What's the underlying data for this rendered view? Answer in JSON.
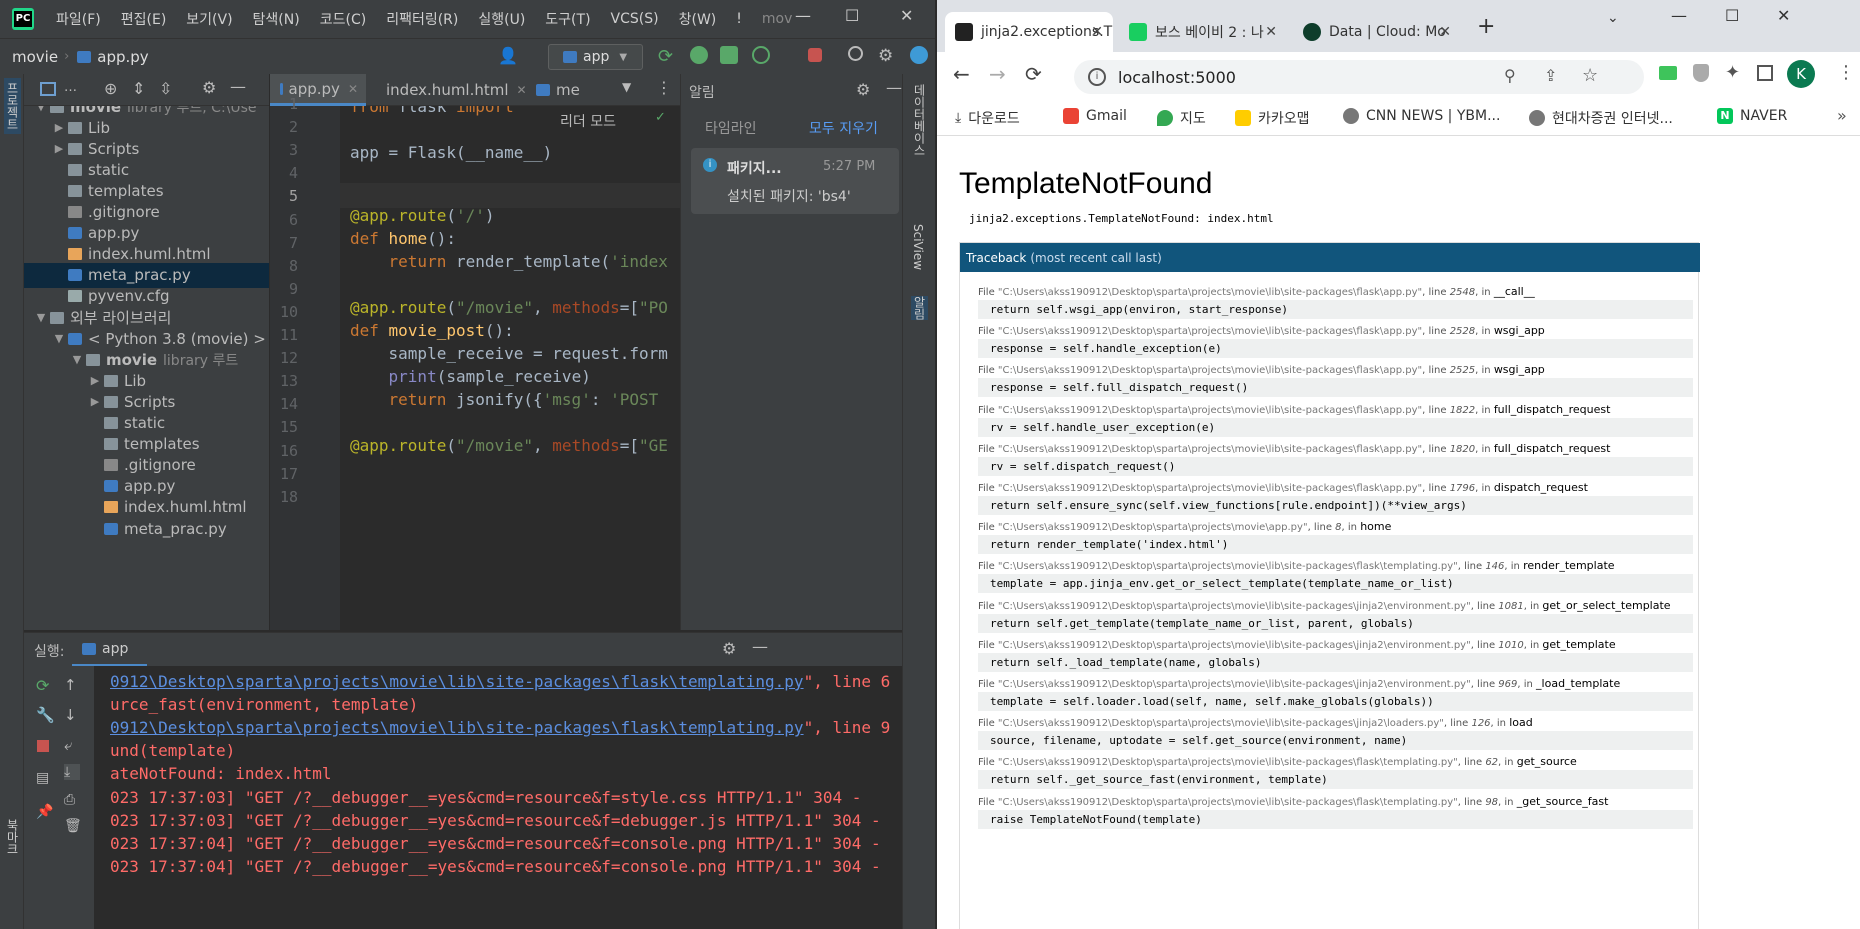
{
  "ide": {
    "menu": [
      "파일(F)",
      "편집(E)",
      "보기(V)",
      "탐색(N)",
      "코드(C)",
      "리팩터링(R)",
      "실행(U)",
      "도구(T)",
      "VCS(S)",
      "창(W)",
      "!",
      "mov"
    ],
    "breadcrumb": {
      "project": "movie",
      "file": "app.py"
    },
    "run_config": "app",
    "left_strip_label": "프로젝트",
    "left_strip_bottom": "북마크",
    "project_tree": [
      {
        "label": "movie",
        "suffix": "library 루트, C:\\Use",
        "type": "folder",
        "open": true
      },
      {
        "label": "Lib",
        "type": "folder"
      },
      {
        "label": "Scripts",
        "type": "folder"
      },
      {
        "label": "static",
        "type": "folder"
      },
      {
        "label": "templates",
        "type": "folder"
      },
      {
        "label": ".gitignore",
        "type": "git"
      },
      {
        "label": "app.py",
        "type": "py"
      },
      {
        "label": "index.huml.html",
        "type": "html"
      },
      {
        "label": "meta_prac.py",
        "type": "py",
        "selected": true
      },
      {
        "label": "pyvenv.cfg",
        "type": "cfg"
      },
      {
        "label": "외부 라이브러리",
        "type": "lib",
        "open": true
      },
      {
        "label": "< Python 3.8 (movie) >",
        "type": "py",
        "open": true
      },
      {
        "label": "movie",
        "suffix": "library 루트",
        "type": "folder",
        "open": true
      },
      {
        "label": "Lib",
        "type": "folder"
      },
      {
        "label": "Scripts",
        "type": "folder"
      },
      {
        "label": "static",
        "type": "folder"
      },
      {
        "label": "templates",
        "type": "folder"
      },
      {
        "label": ".gitignore",
        "type": "git"
      },
      {
        "label": "app.py",
        "type": "py"
      },
      {
        "label": "index.huml.html",
        "type": "html"
      },
      {
        "label": "meta_prac.py",
        "type": "py"
      }
    ],
    "tabs": [
      {
        "label": "app.py",
        "active": true
      },
      {
        "label": "index.huml.html"
      },
      {
        "label": "me"
      }
    ],
    "reader_mode": "리더 모드",
    "line_numbers": [
      "1",
      "2",
      "3",
      "4",
      "5",
      "6",
      "7",
      "8",
      "9",
      "10",
      "11",
      "12",
      "13",
      "14",
      "15",
      "16",
      "17",
      "18"
    ],
    "notifications": {
      "title": "알림",
      "timeline": "타임라인",
      "clear_all": "모두 지우기",
      "item_title": "패키지...",
      "item_time": "5:27 PM",
      "item_body": "설치된 패키지: 'bs4'"
    },
    "right_strip": [
      "데이터베이스",
      "SciView",
      "알림"
    ],
    "run": {
      "label": "실행:",
      "config": "app"
    },
    "console": [
      {
        "text": "0912\\Desktop\\sparta\\projects\\movie\\lib\\site-packages\\flask\\templating.py",
        "tail": "\", line 6",
        "link": true
      },
      {
        "text": "urce_fast(environment, template)"
      },
      {
        "text": "0912\\Desktop\\sparta\\projects\\movie\\lib\\site-packages\\flask\\templating.py",
        "tail": "\", line 9",
        "link": true
      },
      {
        "text": "und(template)"
      },
      {
        "text": "ateNotFound: index.html"
      },
      {
        "text": "023 17:37:03] \"GET /?__debugger__=yes&cmd=resource&f=style.css HTTP/1.1\" 304 -"
      },
      {
        "text": "023 17:37:03] \"GET /?__debugger__=yes&cmd=resource&f=debugger.js HTTP/1.1\" 304 -"
      },
      {
        "text": "023 17:37:04] \"GET /?__debugger__=yes&cmd=resource&f=console.png HTTP/1.1\" 304 -"
      },
      {
        "text": "023 17:37:04] \"GET /?__debugger__=yes&cmd=resource&f=console.png HTTP/1.1\" 304 -"
      }
    ]
  },
  "browser": {
    "tabs": [
      {
        "label": "jinja2.exceptions.T",
        "active": true
      },
      {
        "label": "보스 베이비 2 : 나"
      },
      {
        "label": "Data | Cloud: Mo"
      }
    ],
    "url": "localhost:5000",
    "profile": "K",
    "bookmarks": [
      "다운로드",
      "Gmail",
      "지도",
      "카카오맵",
      "CNN NEWS | YBM...",
      "현대차증권 인터넷...",
      "NAVER"
    ],
    "error_title": "TemplateNotFound",
    "error_message": "jinja2.exceptions.TemplateNotFound: index.html",
    "traceback_label": "Traceback",
    "traceback_note": "(most recent call last)",
    "frames": [
      {
        "path": "\"C:\\Users\\akss190912\\Desktop\\sparta\\projects\\movie\\lib\\site-packages\\flask\\app.py\"",
        "line": "2548",
        "func": "__call__",
        "code": "return self.wsgi_app(environ, start_response)"
      },
      {
        "path": "\"C:\\Users\\akss190912\\Desktop\\sparta\\projects\\movie\\lib\\site-packages\\flask\\app.py\"",
        "line": "2528",
        "func": "wsgi_app",
        "code": "response = self.handle_exception(e)"
      },
      {
        "path": "\"C:\\Users\\akss190912\\Desktop\\sparta\\projects\\movie\\lib\\site-packages\\flask\\app.py\"",
        "line": "2525",
        "func": "wsgi_app",
        "code": "response = self.full_dispatch_request()"
      },
      {
        "path": "\"C:\\Users\\akss190912\\Desktop\\sparta\\projects\\movie\\lib\\site-packages\\flask\\app.py\"",
        "line": "1822",
        "func": "full_dispatch_request",
        "code": "rv = self.handle_user_exception(e)"
      },
      {
        "path": "\"C:\\Users\\akss190912\\Desktop\\sparta\\projects\\movie\\lib\\site-packages\\flask\\app.py\"",
        "line": "1820",
        "func": "full_dispatch_request",
        "code": "rv = self.dispatch_request()"
      },
      {
        "path": "\"C:\\Users\\akss190912\\Desktop\\sparta\\projects\\movie\\lib\\site-packages\\flask\\app.py\"",
        "line": "1796",
        "func": "dispatch_request",
        "code": "return self.ensure_sync(self.view_functions[rule.endpoint])(**view_args)"
      },
      {
        "path": "\"C:\\Users\\akss190912\\Desktop\\sparta\\projects\\movie\\app.py\"",
        "line": "8",
        "func": "home",
        "code": "return render_template('index.html')"
      },
      {
        "path": "\"C:\\Users\\akss190912\\Desktop\\sparta\\projects\\movie\\lib\\site-packages\\flask\\templating.py\"",
        "line": "146",
        "func": "render_template",
        "code": "template = app.jinja_env.get_or_select_template(template_name_or_list)"
      },
      {
        "path": "\"C:\\Users\\akss190912\\Desktop\\sparta\\projects\\movie\\lib\\site-packages\\jinja2\\environment.py\"",
        "line": "1081",
        "func": "get_or_select_template",
        "code": "return self.get_template(template_name_or_list, parent, globals)"
      },
      {
        "path": "\"C:\\Users\\akss190912\\Desktop\\sparta\\projects\\movie\\lib\\site-packages\\jinja2\\environment.py\"",
        "line": "1010",
        "func": "get_template",
        "code": "return self._load_template(name, globals)"
      },
      {
        "path": "\"C:\\Users\\akss190912\\Desktop\\sparta\\projects\\movie\\lib\\site-packages\\jinja2\\environment.py\"",
        "line": "969",
        "func": "_load_template",
        "code": "template = self.loader.load(self, name, self.make_globals(globals))"
      },
      {
        "path": "\"C:\\Users\\akss190912\\Desktop\\sparta\\projects\\movie\\lib\\site-packages\\jinja2\\loaders.py\"",
        "line": "126",
        "func": "load",
        "code": "source, filename, uptodate = self.get_source(environment, name)"
      },
      {
        "path": "\"C:\\Users\\akss190912\\Desktop\\sparta\\projects\\movie\\lib\\site-packages\\flask\\templating.py\"",
        "line": "62",
        "func": "get_source",
        "code": "return self._get_source_fast(environment, template)"
      },
      {
        "path": "\"C:\\Users\\akss190912\\Desktop\\sparta\\projects\\movie\\lib\\site-packages\\flask\\templating.py\"",
        "line": "98",
        "func": "_get_source_fast",
        "code": "raise TemplateNotFound(template)"
      }
    ],
    "frame_labels": {
      "file": "File",
      "line": "line",
      "in": "in"
    }
  }
}
